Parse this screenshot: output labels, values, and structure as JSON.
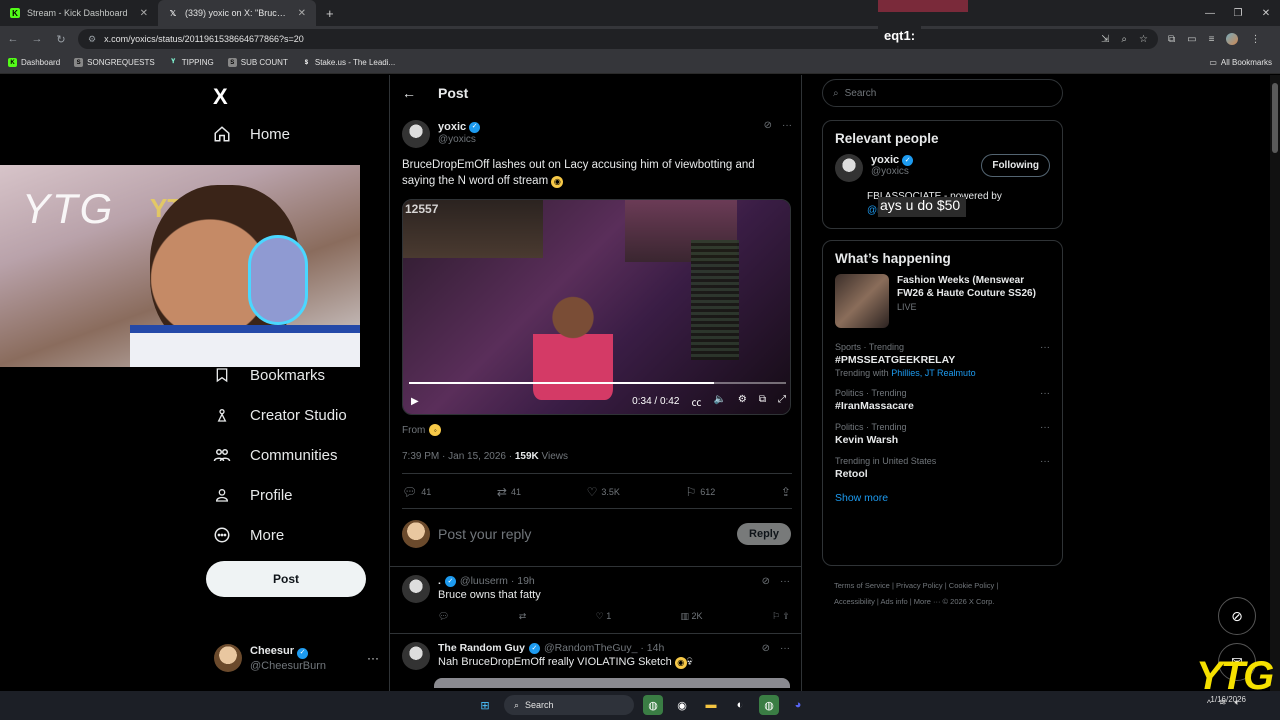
{
  "browser": {
    "tabs": [
      {
        "title": "Stream - Kick Dashboard",
        "icon": "kick-icon",
        "active": false
      },
      {
        "title": "(339) yoxic on X: \"BruceDropEm",
        "icon": "x-icon",
        "active": true
      }
    ],
    "new_tab": "+",
    "url": "x.com/yoxics/status/2011961538664677866?s=20",
    "bookmarks": [
      {
        "label": "Dashboard",
        "icon": "kick-icon",
        "color": "#53fc18"
      },
      {
        "label": "SONGREQUESTS",
        "icon": "streamelements-icon",
        "color": "#888888"
      },
      {
        "label": "TIPPING",
        "icon": "streamlabs-icon",
        "color": "#80f5d2"
      },
      {
        "label": "SUB COUNT",
        "icon": "streamelements-icon",
        "color": "#888888"
      },
      {
        "label": "Stake.us - The Leadi...",
        "icon": "stake-icon",
        "color": "#ffffff"
      }
    ],
    "all_bookmarks": "All Bookmarks"
  },
  "nav": {
    "logo": "X",
    "items": [
      {
        "label": "Home",
        "icon": "home-icon"
      },
      {
        "label": "Bookmarks",
        "icon": "bookmark-icon"
      },
      {
        "label": "Creator Studio",
        "icon": "creator-studio-icon"
      },
      {
        "label": "Communities",
        "icon": "communities-icon"
      },
      {
        "label": "Profile",
        "icon": "profile-icon"
      },
      {
        "label": "More",
        "icon": "more-circle-icon"
      }
    ],
    "post_button": "Post",
    "account": {
      "name": "Cheesur",
      "handle": "@CheesurBurn"
    }
  },
  "post": {
    "header": "Post",
    "author": {
      "name": "yoxic",
      "handle": "@yoxics"
    },
    "text": "BruceDropEmOff lashes out on Lacy accusing him of viewbotting and saying the N word off stream",
    "video": {
      "overlay_count": "12557",
      "time": "0:34 / 0:42",
      "progress": 0.81
    },
    "from_label": "From",
    "timestamp": "7:39 PM · Jan 15, 2026 · ",
    "views_count": "159K",
    "views_label": " Views",
    "stats": {
      "replies": "41",
      "reposts": "41",
      "likes": "3.5K",
      "bookmarks": "612"
    },
    "reply_placeholder": "Post your reply",
    "reply_button": "Reply"
  },
  "replies": [
    {
      "name": ".",
      "handle": "@luuserm · 19h",
      "text": "Bruce owns that fatty",
      "likes": "1",
      "views": "2K"
    },
    {
      "name": "The Random Guy",
      "handle": "@RandomTheGuy_ · 14h",
      "text": "Nah BruceDropEmOff really VIOLATING Sketch"
    }
  ],
  "sidebar": {
    "search_placeholder": "Search",
    "relevant_title": "Relevant people",
    "relevant_user": {
      "name": "yoxic",
      "handle": "@yoxics",
      "button": "Following",
      "bio": "FBI ASSOCIATE - powered by",
      "bio_link": "@rainbetcom"
    },
    "happening_title": "What’s happening",
    "feature": {
      "title": "Fashion Weeks (Menswear FW26 & Haute Couture SS26)",
      "status": "LIVE"
    },
    "trends": [
      {
        "context": "Sports · Trending",
        "name": "#PMSSEATGEEKRELAY",
        "sub_prefix": "Trending with ",
        "sub_links": "Phillies, JT Realmuto"
      },
      {
        "context": "Politics · Trending",
        "name": "#IranMassacare",
        "sub_prefix": "",
        "sub_links": ""
      },
      {
        "context": "Politics · Trending",
        "name": "Kevin Warsh",
        "sub_prefix": "",
        "sub_links": ""
      },
      {
        "context": "Trending in United States",
        "name": "Retool",
        "sub_prefix": "",
        "sub_links": ""
      }
    ],
    "show_more": "Show more",
    "footer": [
      "Terms of Service",
      "Privacy Policy",
      "Cookie Policy",
      "Accessibility",
      "Ads info",
      "More ···",
      "© 2026 X Corp."
    ]
  },
  "overlays": {
    "goal_text": "ays u do $50",
    "eqt_text": "eqt1:",
    "corner_logo": "YTG",
    "webcam_text": "YTG"
  },
  "taskbar": {
    "search": "Search",
    "date": "1/16/2026"
  }
}
